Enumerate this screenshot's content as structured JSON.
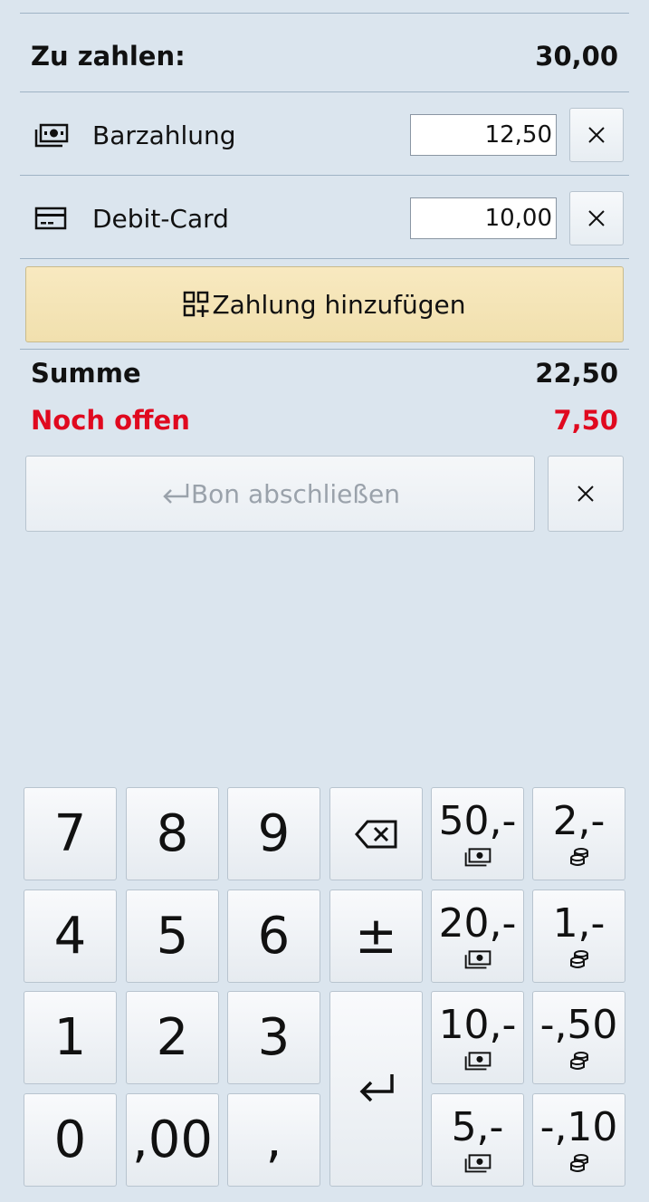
{
  "total": {
    "label": "Zu zahlen:",
    "value": "30,00"
  },
  "payments": [
    {
      "icon": "cash-icon",
      "label": "Barzahlung",
      "amount": "12,50"
    },
    {
      "icon": "card-icon",
      "label": "Debit-Card",
      "amount": "10,00"
    }
  ],
  "add_payment_label": "Zahlung hinzufügen",
  "summary": {
    "sum_label": "Summe",
    "sum_value": "22,50",
    "open_label": "Noch offen",
    "open_value": "7,50"
  },
  "close_receipt_label": "Bon abschließen",
  "colors": {
    "background": "#dbe5ee",
    "open_red": "#e0091f",
    "add_button": "#f3e4b5"
  },
  "keypad": {
    "k7": "7",
    "k8": "8",
    "k9": "9",
    "k4": "4",
    "k5": "5",
    "k6": "6",
    "k1": "1",
    "k2": "2",
    "k3": "3",
    "k0": "0",
    "k00": ",00",
    "kcomma": ",",
    "plusminus": "±",
    "n50": "50,-",
    "n20": "20,-",
    "n10": "10,-",
    "n5": "5,-",
    "c2": "2,-",
    "c1": "1,-",
    "c050": "-,50",
    "c010": "-,10"
  }
}
